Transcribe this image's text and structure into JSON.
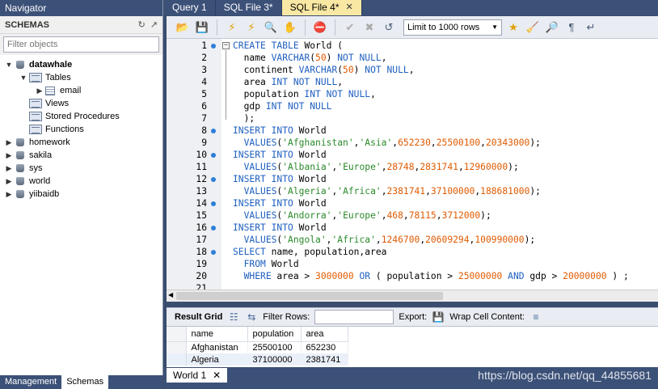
{
  "navigator": {
    "title": "Navigator",
    "schemas_label": "SCHEMAS",
    "filter_placeholder": "Filter objects",
    "tree": [
      {
        "label": "datawhale",
        "expanded": true,
        "bold": true
      },
      {
        "label": "Tables",
        "expanded": true
      },
      {
        "label": "email"
      },
      {
        "label": "Views"
      },
      {
        "label": "Stored Procedures"
      },
      {
        "label": "Functions"
      },
      {
        "label": "homework"
      },
      {
        "label": "sakila"
      },
      {
        "label": "sys"
      },
      {
        "label": "world"
      },
      {
        "label": "yiibaidb"
      }
    ],
    "bottom_tabs": [
      "Management",
      "Schemas"
    ]
  },
  "editor_tabs": [
    "Query 1",
    "SQL File 3*",
    "SQL File 4*"
  ],
  "toolbar": {
    "limit_label": "Limit to 1000 rows"
  },
  "code_lines": [
    "CREATE TABLE World (",
    "  name VARCHAR(50) NOT NULL,",
    "  continent VARCHAR(50) NOT NULL,",
    "  area INT NOT NULL,",
    "  population INT NOT NULL,",
    "  gdp INT NOT NULL",
    "  );",
    "INSERT INTO World",
    "  VALUES('Afghanistan','Asia',652230,25500100,20343000);",
    "INSERT INTO World",
    "  VALUES('Albania','Europe',28748,2831741,12960000);",
    "INSERT INTO World",
    "  VALUES('Algeria','Africa',2381741,37100000,188681000);",
    "INSERT INTO World",
    "  VALUES('Andorra','Europe',468,78115,3712000);",
    "INSERT INTO World",
    "  VALUES('Angola','Africa',1246700,20609294,100990000);",
    "SELECT name, population,area",
    "  FROM World",
    "  WHERE area > 3000000 OR ( population > 25000000 AND gdp > 20000000 ) ;",
    ""
  ],
  "results": {
    "result_grid_label": "Result Grid",
    "filter_rows_label": "Filter Rows:",
    "export_label": "Export:",
    "wrap_label": "Wrap Cell Content:",
    "columns": [
      "name",
      "population",
      "area"
    ],
    "rows": [
      [
        "Afghanistan",
        "25500100",
        "652230"
      ],
      [
        "Algeria",
        "37100000",
        "2381741"
      ]
    ]
  },
  "bottom_tab": "World 1",
  "watermark": "https://blog.csdn.net/qq_44855681"
}
